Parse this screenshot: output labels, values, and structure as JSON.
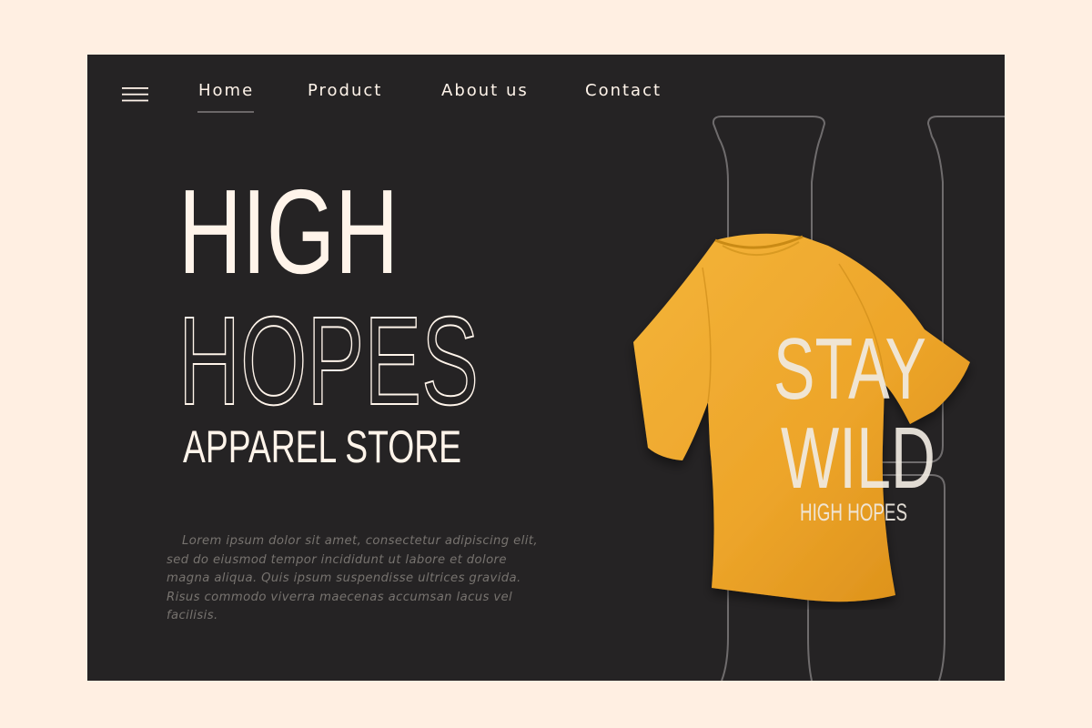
{
  "nav": {
    "menu_icon": "hamburger-menu-icon",
    "items": [
      "Home",
      "Product",
      "About us",
      "Contact"
    ],
    "active_index": 0
  },
  "hero": {
    "line1": "HIGH",
    "line2": "HOPES",
    "subtitle": "APPAREL STORE",
    "description": "Lorem ipsum dolor sit amet, consectetur adipiscing elit, sed do eiusmod tempor incididunt ut labore et dolore magna aliqua. Quis ipsum suspendisse ultrices gravida. Risus commodo viverra maecenas accumsan lacus vel facilisis."
  },
  "shirt": {
    "line1": "STAY",
    "line2": "WILD",
    "line3": "HIGH HOPES"
  },
  "colors": {
    "page_background": "#ffefe2",
    "panel_background": "#252324",
    "cream_text": "#fff4ea",
    "shirt_yellow": "#f0a928",
    "outline_gray": "#6f6c6d",
    "body_text": "#77736f"
  }
}
